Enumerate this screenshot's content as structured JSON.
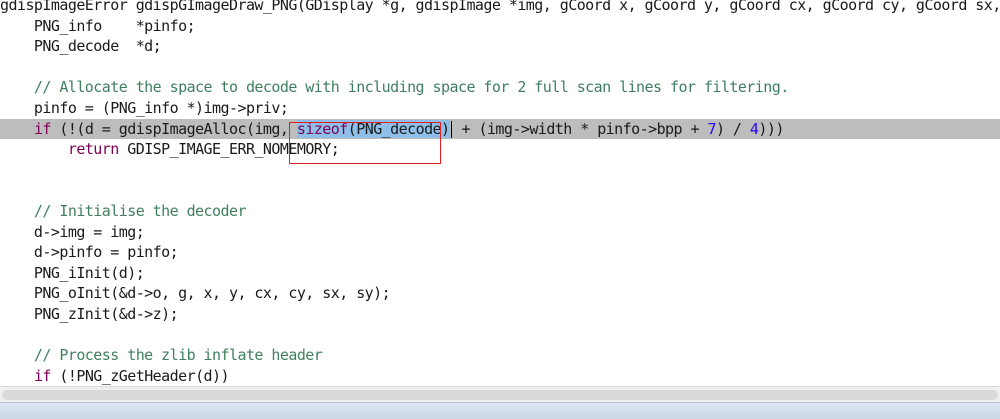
{
  "editor": {
    "lines": [
      {
        "segments": [
          {
            "t": "gdispImageError gdispGImageDraw_PNG(GDisplay *g, gdispImage *img, gCoord x, gCoord y, gCoord cx, gCoord cy, gCoord sx, gCoord sy) {"
          }
        ]
      },
      {
        "segments": [
          {
            "t": "    PNG_info    *pinfo;"
          }
        ]
      },
      {
        "segments": [
          {
            "t": "    PNG_decode  *d;"
          }
        ]
      },
      {
        "segments": [
          {
            "t": ""
          }
        ]
      },
      {
        "segments": [
          {
            "t": "    // Allocate the space to decode with including space for 2 full scan lines for filtering.",
            "c": "cm"
          }
        ]
      },
      {
        "segments": [
          {
            "t": "    pinfo = (PNG_info *)img->priv;"
          }
        ]
      },
      {
        "current": true,
        "segments": [
          {
            "t": "    "
          },
          {
            "t": "if",
            "c": "kw"
          },
          {
            "t": " (!(d = gdispImageAlloc(img, "
          },
          {
            "t": "sizeof",
            "c": "kw sel"
          },
          {
            "t": "(PNG_decode)",
            "c": "sel"
          },
          {
            "caret": true
          },
          {
            "t": " + (img->width * pinfo->bpp + "
          },
          {
            "t": "7",
            "c": "num"
          },
          {
            "t": ") / "
          },
          {
            "t": "4",
            "c": "num"
          },
          {
            "t": ")))"
          }
        ]
      },
      {
        "segments": [
          {
            "t": "        "
          },
          {
            "t": "return",
            "c": "kw"
          },
          {
            "t": " GDISP_IMAGE_ERR_NOMEMORY;"
          }
        ]
      },
      {
        "segments": [
          {
            "t": ""
          }
        ]
      },
      {
        "segments": [
          {
            "t": ""
          }
        ]
      },
      {
        "segments": [
          {
            "t": "    // Initialise the decoder",
            "c": "cm"
          }
        ]
      },
      {
        "segments": [
          {
            "t": "    d->img = img;"
          }
        ]
      },
      {
        "segments": [
          {
            "t": "    d->pinfo = pinfo;"
          }
        ]
      },
      {
        "segments": [
          {
            "t": "    PNG_iInit(d);"
          }
        ]
      },
      {
        "segments": [
          {
            "t": "    PNG_oInit(&d->o, g, x, y, cx, cy, sx, sy);"
          }
        ]
      },
      {
        "segments": [
          {
            "t": "    PNG_zInit(&d->z);"
          }
        ]
      },
      {
        "segments": [
          {
            "t": ""
          }
        ]
      },
      {
        "segments": [
          {
            "t": "    // Process the zlib inflate header",
            "c": "cm"
          }
        ]
      },
      {
        "segments": [
          {
            "t": "    "
          },
          {
            "t": "if",
            "c": "kw"
          },
          {
            "t": " (!PNG_zGetHeader(d))"
          }
        ]
      }
    ]
  },
  "colors": {
    "keyword": "#7f0055",
    "comment": "#3f7f5f",
    "number": "#2a00ff",
    "current_line": "#bdbdbd",
    "selection": "#8fbfe8",
    "annotation_box": "#e02020"
  }
}
